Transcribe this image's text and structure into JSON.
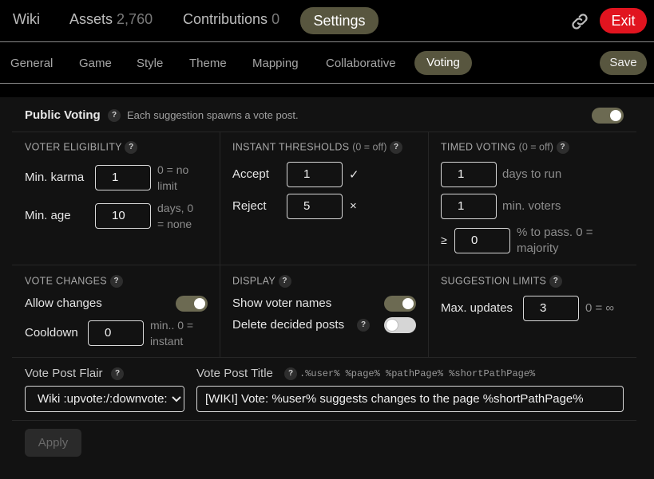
{
  "topbar": {
    "wiki": "Wiki",
    "assets_label": "Assets",
    "assets_count": "2,760",
    "contributions_label": "Contributions",
    "contributions_count": "0",
    "settings": "Settings",
    "link_icon": "link-icon",
    "exit": "Exit"
  },
  "tabs": {
    "general": "General",
    "game": "Game",
    "style": "Style",
    "theme": "Theme",
    "mapping": "Mapping",
    "collaborative": "Collaborative",
    "voting": "Voting",
    "save": "Save"
  },
  "public_voting": {
    "title": "Public Voting",
    "help": "?",
    "description": "Each suggestion spawns a vote post.",
    "enabled": true
  },
  "voter_eligibility": {
    "title": "VOTER ELIGIBILITY",
    "help": "?",
    "min_karma_label": "Min. karma",
    "min_karma_value": "1",
    "min_karma_hint_1": "0 = no",
    "min_karma_hint_2": "limit",
    "min_age_label": "Min. age",
    "min_age_value": "10",
    "min_age_hint_1": "days, 0",
    "min_age_hint_2": "= none"
  },
  "instant_thresholds": {
    "title": "INSTANT THRESHOLDS",
    "subtitle": "(0 = off)",
    "help": "?",
    "accept_label": "Accept",
    "accept_value": "1",
    "accept_glyph": "✓",
    "reject_label": "Reject",
    "reject_value": "5",
    "reject_glyph": "×"
  },
  "timed_voting": {
    "title": "TIMED VOTING",
    "subtitle": "(0 = off)",
    "help": "?",
    "days_value": "1",
    "days_label": "days to run",
    "voters_value": "1",
    "voters_label": "min. voters",
    "pass_symbol": "≥",
    "pass_value": "0",
    "pass_hint_1": "% to pass. 0 =",
    "pass_hint_2": "majority"
  },
  "vote_changes": {
    "title": "VOTE CHANGES",
    "help": "?",
    "allow_label": "Allow changes",
    "allow_enabled": true,
    "cooldown_label": "Cooldown",
    "cooldown_value": "0",
    "cooldown_hint_1": "min.. 0 =",
    "cooldown_hint_2": "instant"
  },
  "display": {
    "title": "DISPLAY",
    "help": "?",
    "show_names_label": "Show voter names",
    "show_names_enabled": true,
    "delete_label": "Delete decided posts",
    "delete_help": "?",
    "delete_enabled": false
  },
  "suggestion_limits": {
    "title": "SUGGESTION LIMITS",
    "help": "?",
    "max_updates_label": "Max. updates",
    "max_updates_value": "3",
    "max_updates_hint": "0 = ∞"
  },
  "vote_post": {
    "flair_label": "Vote Post Flair",
    "flair_help": "?",
    "flair_value": "Wiki :upvote:/:downvote:",
    "title_label": "Vote Post Title",
    "title_help": "?",
    "placeholders": ".%user% %page% %pathPage% %shortPathPage%",
    "title_value": "[WIKI] Vote: %user% suggests changes to the page %shortPathPage%"
  },
  "apply": "Apply",
  "colors": {
    "background": "#000000",
    "panel": "#121212",
    "accent": "#58563f",
    "exit": "#e1141f"
  }
}
